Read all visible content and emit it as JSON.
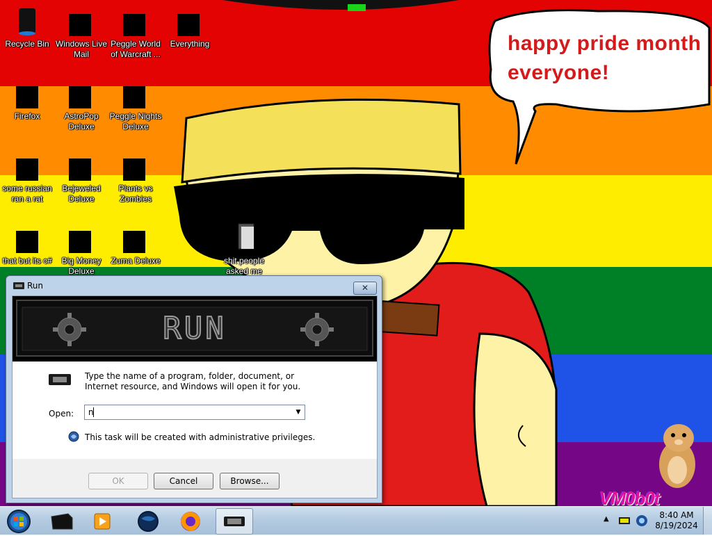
{
  "desktop": {
    "wallpaper": {
      "stripes": [
        "#e40303",
        "#ff8c00",
        "#ffed00",
        "#008026",
        "#1f52e6",
        "#750787"
      ],
      "speech_bubble": "happy pride month everyone!",
      "watermark": "VM0b0t"
    },
    "icons": [
      {
        "label": "Recycle Bin",
        "icon": "recycle-bin-icon"
      },
      {
        "label": "Windows Live Mail",
        "icon": "mail-icon"
      },
      {
        "label": "Peggle World of Warcraft ...",
        "icon": "peggle-icon"
      },
      {
        "label": "Everything",
        "icon": "search-app-icon"
      },
      {
        "label": "Firefox",
        "icon": "firefox-icon"
      },
      {
        "label": "AstroPop Deluxe",
        "icon": "astropop-icon"
      },
      {
        "label": "Peggle Nights Deluxe",
        "icon": "peggle-nights-icon"
      },
      {
        "label": "some russian ran a rat",
        "icon": "app-icon"
      },
      {
        "label": "Bejeweled Deluxe",
        "icon": "gem-icon"
      },
      {
        "label": "Plants vs Zombies",
        "icon": "plant-icon"
      },
      {
        "label": "that but its c#",
        "icon": "windows-stack-icon"
      },
      {
        "label": "Big Money Deluxe",
        "icon": "money-bag-icon"
      },
      {
        "label": "Zuma Deluxe",
        "icon": "zuma-icon"
      },
      {
        "label": "shit people asked me",
        "icon": "folder-icon"
      }
    ]
  },
  "run_dialog": {
    "title": "Run",
    "banner_text": "RUN",
    "description": "Type the name of a program, folder, document, or Internet resource, and Windows will open it for you.",
    "open_label": "Open:",
    "open_value": "n",
    "admin_note": "This task will be created with administrative privileges.",
    "buttons": {
      "ok": "OK",
      "cancel": "Cancel",
      "browse": "Browse..."
    }
  },
  "taskbar": {
    "items": [
      "start-orb-icon",
      "terminal-icon",
      "media-player-icon",
      "globe-icon",
      "firefox-icon",
      "run-icon"
    ],
    "clock": {
      "time": "8:40 AM",
      "date": "8/19/2024"
    }
  }
}
